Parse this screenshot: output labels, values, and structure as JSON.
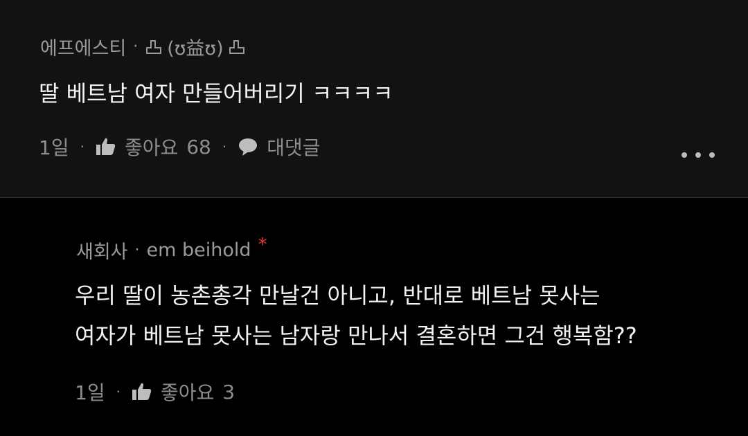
{
  "comments": [
    {
      "author": "에프에스티",
      "nickname": "(ʊ益ʊ)",
      "text_lines": [
        "딸 베트남 여자 만들어버리기 ㅋㅋㅋㅋ"
      ],
      "time": "1일",
      "like_label": "좋아요",
      "like_count": "68",
      "reply_label": "대댓글"
    },
    {
      "author": "새회사",
      "nickname": "em beihold",
      "marker": "*",
      "text_lines": [
        "우리 딸이 농촌총각 만날건 아니고, 반대로 베트남 못사는",
        "여자가 베트남 못사는 남자랑 만나서 결혼하면 그건 행복함??"
      ],
      "time": "1일",
      "like_label": "좋아요",
      "like_count": "3"
    }
  ],
  "separator": "·",
  "colors": {
    "background_top": "#121212",
    "background_bottom": "#000000",
    "text_primary": "#f2f2f2",
    "text_secondary": "#9b9b9b",
    "marker": "#e53935"
  },
  "icons": [
    "crown-icon",
    "thumbs-up-icon",
    "chat-bubble-icon",
    "more-options-icon"
  ]
}
